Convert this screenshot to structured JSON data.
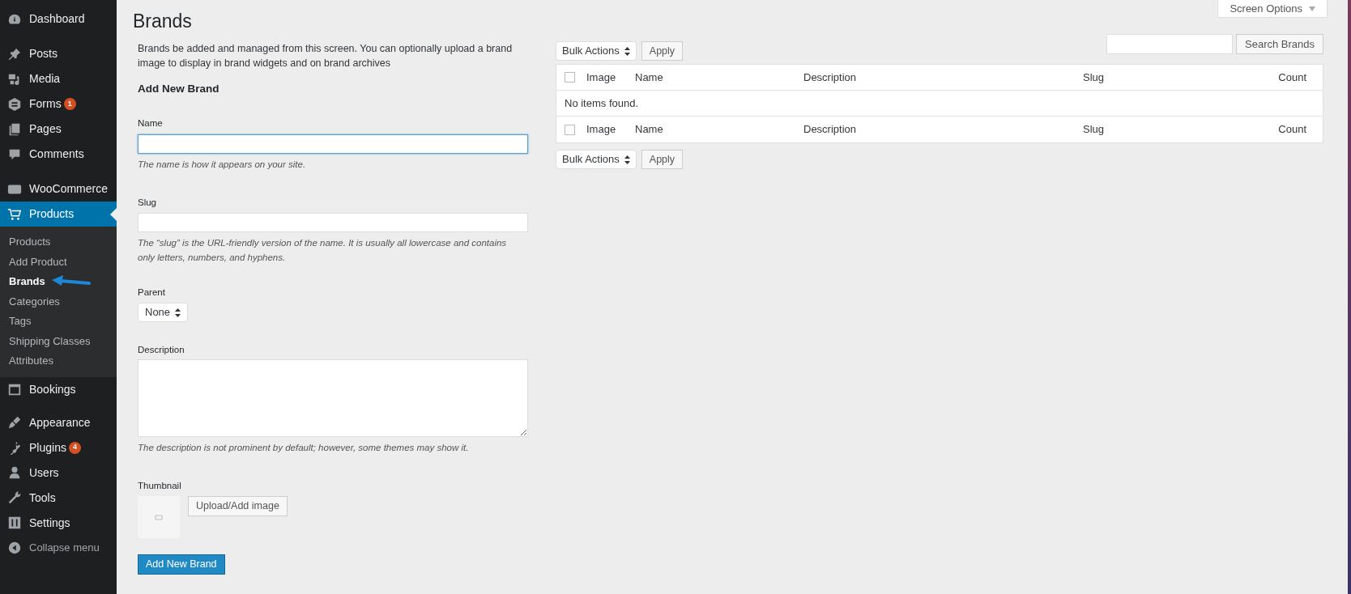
{
  "sidebar": {
    "items": [
      {
        "label": "Dashboard",
        "kind": "main",
        "selected": false
      },
      {
        "label": "Posts",
        "kind": "main",
        "selected": false
      },
      {
        "label": "Media",
        "kind": "main",
        "selected": false
      },
      {
        "label": "Forms",
        "kind": "main",
        "selected": false,
        "badge": "1"
      },
      {
        "label": "Pages",
        "kind": "main",
        "selected": false
      },
      {
        "label": "Comments",
        "kind": "main",
        "selected": false
      },
      {
        "label": "WooCommerce",
        "kind": "main",
        "selected": false
      },
      {
        "label": "Products",
        "kind": "main",
        "selected": true,
        "children": [
          {
            "label": "Products",
            "selected": false
          },
          {
            "label": "Add Product",
            "selected": false
          },
          {
            "label": "Brands",
            "selected": true
          },
          {
            "label": "Categories",
            "selected": false
          },
          {
            "label": "Tags",
            "selected": false
          },
          {
            "label": "Shipping Classes",
            "selected": false
          },
          {
            "label": "Attributes",
            "selected": false
          }
        ]
      },
      {
        "label": "Bookings",
        "kind": "main",
        "selected": false
      },
      {
        "label": "Appearance",
        "kind": "main",
        "selected": false
      },
      {
        "label": "Plugins",
        "kind": "main",
        "selected": false,
        "badge": "4"
      },
      {
        "label": "Users",
        "kind": "main",
        "selected": false
      },
      {
        "label": "Tools",
        "kind": "main",
        "selected": false
      },
      {
        "label": "Settings",
        "kind": "main",
        "selected": false
      },
      {
        "label": "Collapse menu",
        "kind": "collapse",
        "selected": false
      }
    ]
  },
  "page": {
    "title": "Brands",
    "screen_options": "Screen Options"
  },
  "search": {
    "button": "Search Brands"
  },
  "form": {
    "intro": "Brands be added and managed from this screen. You can optionally upload a brand image to display in brand widgets and on brand archives",
    "heading": "Add New Brand",
    "name": {
      "label": "Name",
      "focused": true,
      "hint": "The name is how it appears on your site."
    },
    "slug": {
      "label": "Slug",
      "focused": false,
      "hint": "The “slug” is the URL-friendly version of the name. It is usually all lowercase and contains only letters, numbers, and hyphens."
    },
    "parent": {
      "label": "Parent",
      "value": "None"
    },
    "description": {
      "label": "Description",
      "hint": "The description is not prominent by default; however, some themes may show it."
    },
    "thumbnail": {
      "label": "Thumbnail",
      "button": "Upload/Add image"
    },
    "submit": "Add New Brand"
  },
  "bulk_top": {
    "select": "Bulk Actions",
    "button": "Apply"
  },
  "table": {
    "header": {
      "checked": false,
      "columns": [
        "Image",
        "Name",
        "Description",
        "Slug",
        "Count"
      ]
    },
    "empty": "No items found.",
    "footer": {
      "checked": false,
      "columns": [
        "Image",
        "Name",
        "Description",
        "Slug",
        "Count"
      ]
    }
  },
  "bulk_bottom": {
    "select": "Bulk Actions",
    "button": "Apply"
  }
}
